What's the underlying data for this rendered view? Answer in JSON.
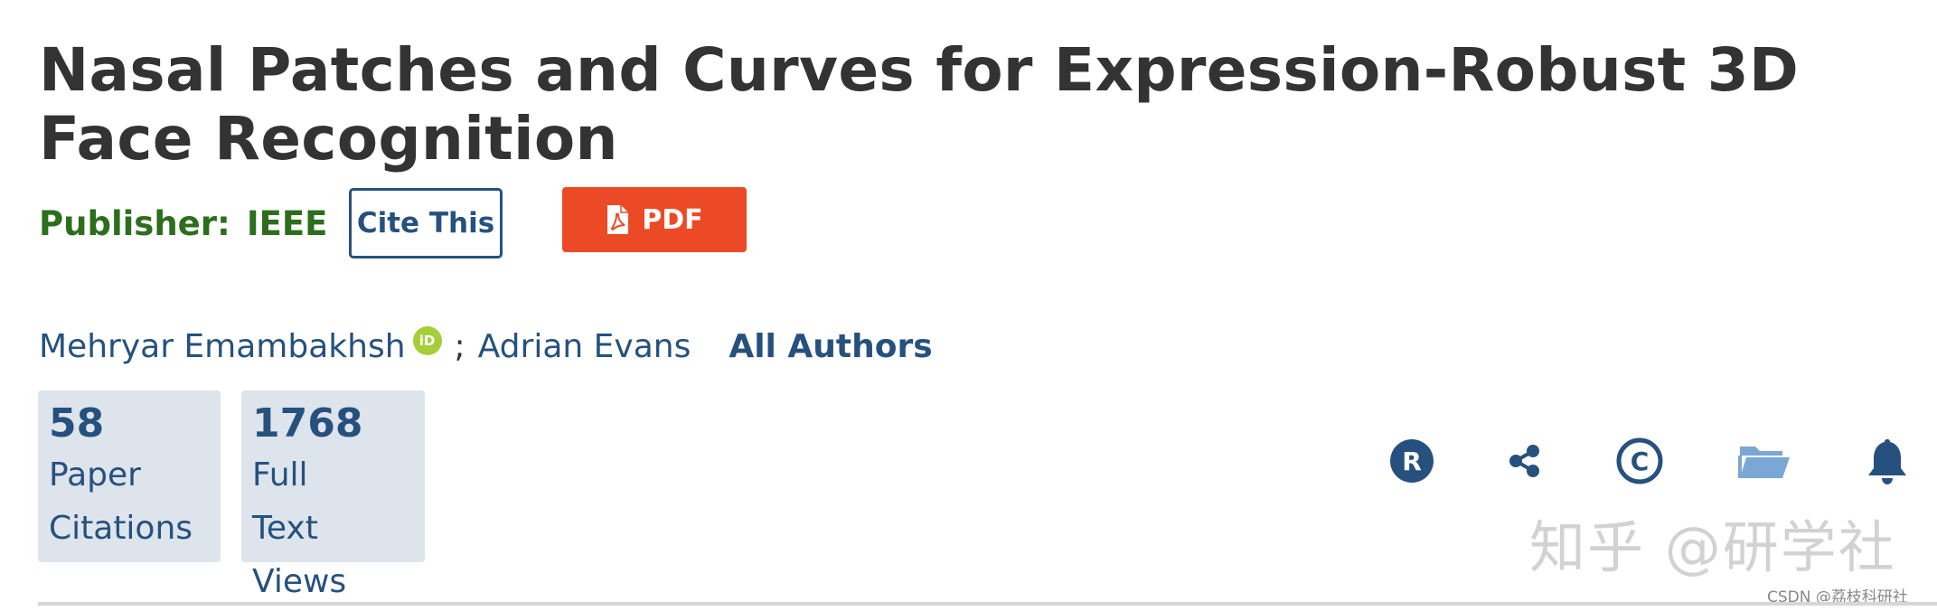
{
  "document": {
    "title": "Nasal Patches and Curves for Expression-Robust 3D Face Recognition"
  },
  "publisher": {
    "label": "Publisher:",
    "value": "IEEE"
  },
  "actions": {
    "cite_label": "Cite This",
    "pdf_label": "PDF"
  },
  "authors": {
    "list": [
      {
        "name": "Mehryar Emambakhsh",
        "orcid": "iD"
      },
      {
        "name": "Adrian Evans"
      }
    ],
    "separator": ";",
    "all_authors_label": "All Authors"
  },
  "metrics": [
    {
      "count": "58",
      "label_lines": [
        "Paper",
        "Citations"
      ]
    },
    {
      "count": "1768",
      "label_lines": [
        "Full",
        "Text",
        "Views"
      ]
    }
  ],
  "toolbar_icons": [
    {
      "name": "r-badge-icon",
      "glyph": "R"
    },
    {
      "name": "share-icon"
    },
    {
      "name": "copyright-icon",
      "glyph": "C"
    },
    {
      "name": "folder-icon"
    },
    {
      "name": "bell-icon"
    }
  ],
  "watermarks": {
    "zhihu": "知乎 @研学社",
    "csdn": "CSDN @荔枝科研社"
  },
  "colors": {
    "title": "#333333",
    "publisher": "#2c6e1c",
    "link": "#26517e",
    "pdf_button": "#ec4a26",
    "metric_bg": "#dde4eb",
    "orcid": "#a6ce39",
    "folder_icon": "#7aa7d6"
  }
}
